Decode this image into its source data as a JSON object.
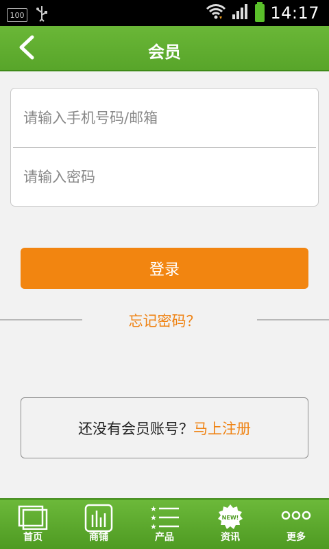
{
  "status_bar": {
    "battery_level": "100",
    "time": "14:17"
  },
  "header": {
    "title": "会员"
  },
  "form": {
    "phone_email_placeholder": "请输入手机号码/邮箱",
    "phone_email_value": "",
    "password_placeholder": "请输入密码",
    "password_value": ""
  },
  "login_button_label": "登录",
  "forgot_password_label": "忘记密码？",
  "register": {
    "prompt": "还没有会员账号？",
    "link_label": "马上注册"
  },
  "tabs": [
    {
      "label": "首页",
      "icon": "home-icon"
    },
    {
      "label": "商铺",
      "icon": "shop-chart-icon"
    },
    {
      "label": "产品",
      "icon": "product-list-icon"
    },
    {
      "label": "资讯",
      "icon": "news-badge-icon"
    },
    {
      "label": "更多",
      "icon": "more-dots-icon"
    }
  ],
  "colors": {
    "header_green": "#5cab2e",
    "accent_orange": "#f28510",
    "battery_green": "#5ac02a"
  }
}
